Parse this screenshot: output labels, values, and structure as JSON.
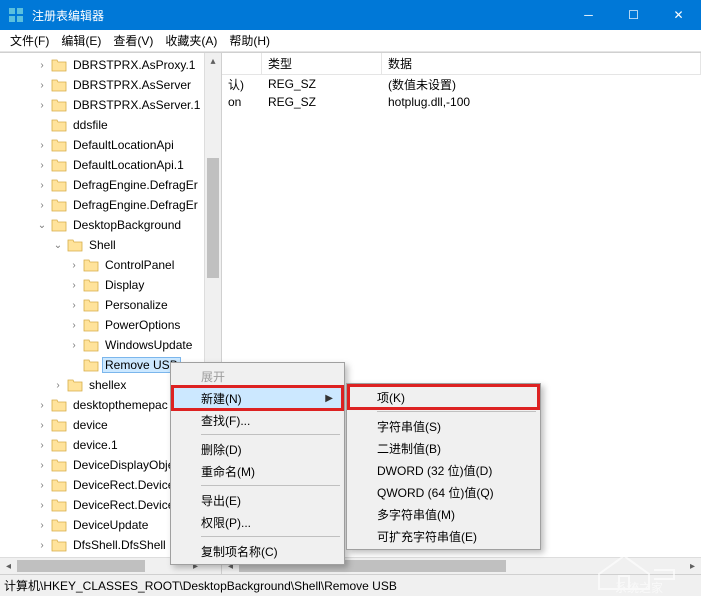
{
  "window": {
    "title": "注册表编辑器"
  },
  "menubar": {
    "file": "文件(F)",
    "edit": "编辑(E)",
    "view": "查看(V)",
    "favorites": "收藏夹(A)",
    "help": "帮助(H)"
  },
  "tree": {
    "items": [
      {
        "indent": 2,
        "chev": "›",
        "label": "DBRSTPRX.AsProxy.1"
      },
      {
        "indent": 2,
        "chev": "›",
        "label": "DBRSTPRX.AsServer"
      },
      {
        "indent": 2,
        "chev": "›",
        "label": "DBRSTPRX.AsServer.1"
      },
      {
        "indent": 2,
        "chev": "",
        "label": "ddsfile"
      },
      {
        "indent": 2,
        "chev": "›",
        "label": "DefaultLocationApi"
      },
      {
        "indent": 2,
        "chev": "›",
        "label": "DefaultLocationApi.1"
      },
      {
        "indent": 2,
        "chev": "›",
        "label": "DefragEngine.DefragEr"
      },
      {
        "indent": 2,
        "chev": "›",
        "label": "DefragEngine.DefragEr"
      },
      {
        "indent": 2,
        "chev": "⌄",
        "label": "DesktopBackground"
      },
      {
        "indent": 3,
        "chev": "⌄",
        "label": "Shell"
      },
      {
        "indent": 4,
        "chev": "›",
        "label": "ControlPanel"
      },
      {
        "indent": 4,
        "chev": "›",
        "label": "Display"
      },
      {
        "indent": 4,
        "chev": "›",
        "label": "Personalize"
      },
      {
        "indent": 4,
        "chev": "›",
        "label": "PowerOptions"
      },
      {
        "indent": 4,
        "chev": "›",
        "label": "WindowsUpdate"
      },
      {
        "indent": 4,
        "chev": "",
        "label": "Remove USB",
        "selected": true
      },
      {
        "indent": 3,
        "chev": "›",
        "label": "shellex"
      },
      {
        "indent": 2,
        "chev": "›",
        "label": "desktopthemepac"
      },
      {
        "indent": 2,
        "chev": "›",
        "label": "device"
      },
      {
        "indent": 2,
        "chev": "›",
        "label": "device.1"
      },
      {
        "indent": 2,
        "chev": "›",
        "label": "DeviceDisplayObje"
      },
      {
        "indent": 2,
        "chev": "›",
        "label": "DeviceRect.Device"
      },
      {
        "indent": 2,
        "chev": "›",
        "label": "DeviceRect.Device"
      },
      {
        "indent": 2,
        "chev": "›",
        "label": "DeviceUpdate"
      },
      {
        "indent": 2,
        "chev": "›",
        "label": "DfsShell.DfsShell"
      }
    ]
  },
  "list": {
    "headers": {
      "name_frag": "",
      "type": "类型",
      "data": "数据"
    },
    "rows": [
      {
        "name_frag": "认)",
        "type": "REG_SZ",
        "data": "(数值未设置)"
      },
      {
        "name_frag": "on",
        "type": "REG_SZ",
        "data": "hotplug.dll,-100"
      }
    ]
  },
  "context_menu_1": {
    "expand": "展开",
    "new": "新建(N)",
    "find": "查找(F)...",
    "delete": "删除(D)",
    "rename": "重命名(M)",
    "export": "导出(E)",
    "permissions": "权限(P)...",
    "copy_key": "复制项名称(C)"
  },
  "context_menu_2": {
    "key": "项(K)",
    "string": "字符串值(S)",
    "binary": "二进制值(B)",
    "dword": "DWORD (32 位)值(D)",
    "qword": "QWORD (64 位)值(Q)",
    "multi": "多字符串值(M)",
    "expand": "可扩充字符串值(E)"
  },
  "statusbar": {
    "path": "计算机\\HKEY_CLASSES_ROOT\\DesktopBackground\\Shell\\Remove USB"
  },
  "watermark": {
    "text": "系统之家"
  }
}
